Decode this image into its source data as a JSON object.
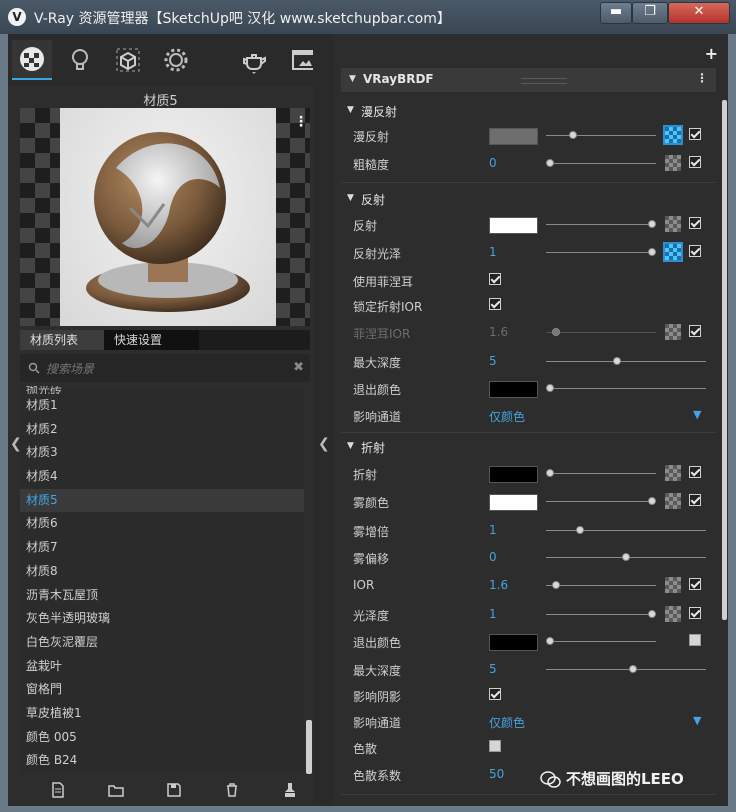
{
  "window": {
    "title": "V-Ray 资源管理器【SketchUp吧 汉化 www.sketchupbar.com】",
    "icon_letter": "V",
    "min_label": "▬",
    "max_label": "❐",
    "close_label": "✕"
  },
  "toolbar": {
    "items": [
      "materials-icon",
      "light-bulb-icon",
      "geometry-cube-icon",
      "settings-gear-icon",
      "teapot-render-icon",
      "frame-buffer-icon"
    ]
  },
  "preview": {
    "material_name": "材质5",
    "menu_label": "⋮"
  },
  "tabs": {
    "material_list": "材质列表",
    "quick_settings": "快速设置"
  },
  "search": {
    "placeholder": "搜索场景",
    "clear_label": "✖"
  },
  "materials": {
    "partial_top": "抛光砖",
    "items": [
      "材质1",
      "材质2",
      "材质3",
      "材质4",
      "材质5",
      "材质6",
      "材质7",
      "材质8",
      "沥青木瓦屋顶",
      "灰色半透明玻璃",
      "白色灰泥覆层",
      "盆栽叶",
      "窗格門",
      "草皮植被1",
      "颜色 005",
      "颜色 B24"
    ],
    "selected": "材质5"
  },
  "panel": {
    "plus_label": "+",
    "header_title": "VRayBRDF",
    "header_menu": "⋮"
  },
  "diffuse": {
    "section": "漫反射",
    "diffuse_label": "漫反射",
    "diffuse_color": "#6e6e6e",
    "roughness_label": "粗糙度",
    "roughness_value": "0"
  },
  "reflection": {
    "section": "反射",
    "reflect_label": "反射",
    "reflect_color": "#ffffff",
    "gloss_label": "反射光泽",
    "gloss_value": "1",
    "fresnel_label": "使用菲涅耳",
    "lock_ior_label": "锁定折射IOR",
    "fresnel_ior_label": "菲涅耳IOR",
    "fresnel_ior_value": "1.6",
    "max_depth_label": "最大深度",
    "max_depth_value": "5",
    "exit_color_label": "退出颜色",
    "exit_color": "#000000",
    "affect_channels_label": "影响通道",
    "affect_channels_value": "仅颜色"
  },
  "refraction": {
    "section": "折射",
    "refract_label": "折射",
    "refract_color": "#000000",
    "fog_color_label": "雾颜色",
    "fog_color": "#ffffff",
    "fog_mult_label": "雾增倍",
    "fog_mult_value": "1",
    "fog_bias_label": "雾偏移",
    "fog_bias_value": "0",
    "ior_label": "IOR",
    "ior_value": "1.6",
    "gloss_label": "光泽度",
    "gloss_value": "1",
    "exit_color_label": "退出颜色",
    "exit_color": "#000000",
    "max_depth_label": "最大深度",
    "max_depth_value": "5",
    "affect_shadows_label": "影响阴影",
    "affect_channels_label": "影响通道",
    "affect_channels_value": "仅颜色",
    "dispersion_label": "色散",
    "dispersion_abbe_label": "色散系数",
    "dispersion_abbe_value": "50"
  },
  "watermark": {
    "text": "不想画图的LEEO"
  },
  "colors": {
    "accent": "#3fa9e8"
  }
}
